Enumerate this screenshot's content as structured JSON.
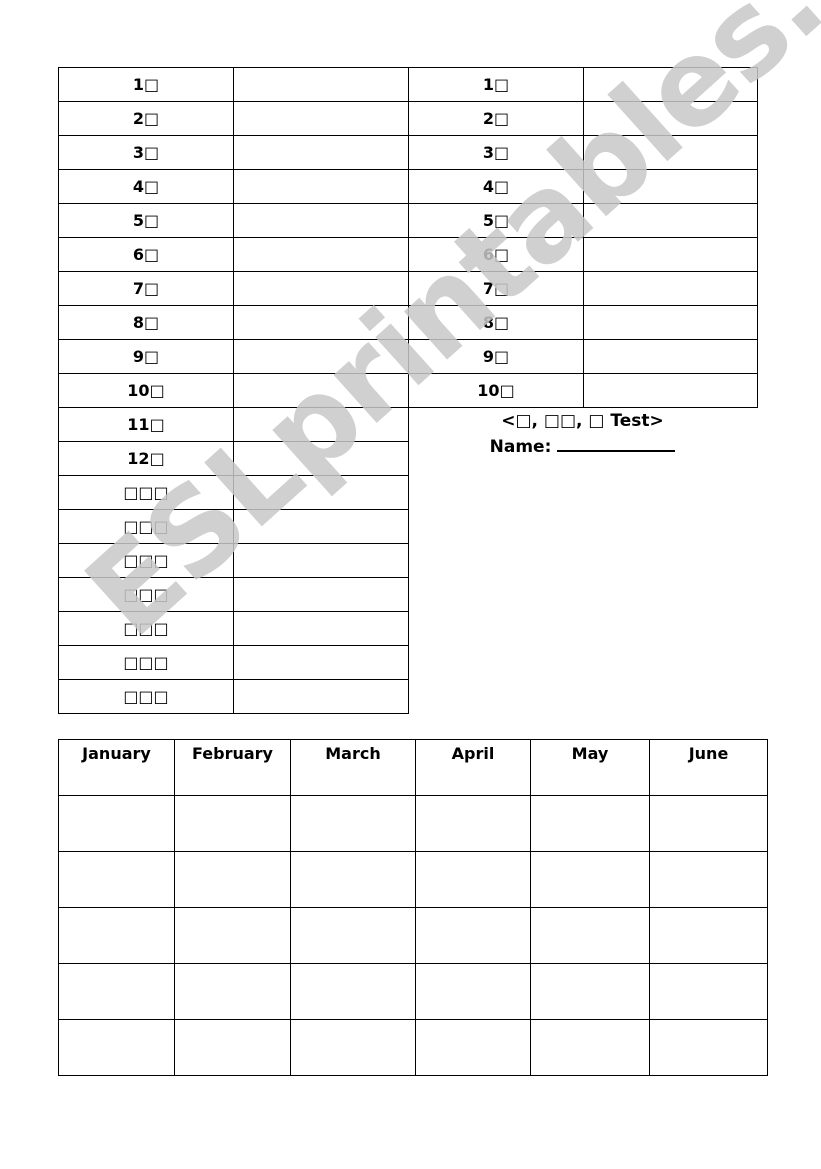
{
  "left_table": {
    "rows": [
      {
        "label": "1□"
      },
      {
        "label": "2□"
      },
      {
        "label": "3□"
      },
      {
        "label": "4□"
      },
      {
        "label": "5□"
      },
      {
        "label": "6□"
      },
      {
        "label": "7□"
      },
      {
        "label": "8□"
      },
      {
        "label": "9□"
      },
      {
        "label": "10□"
      },
      {
        "label": "11□"
      },
      {
        "label": "12□"
      },
      {
        "label": "□□□"
      },
      {
        "label": "□□□"
      },
      {
        "label": "□□□"
      },
      {
        "label": "□□□"
      },
      {
        "label": "□□□"
      },
      {
        "label": "□□□"
      },
      {
        "label": "□□□"
      }
    ]
  },
  "right_table": {
    "rows": [
      {
        "label": "1□"
      },
      {
        "label": "2□"
      },
      {
        "label": "3□"
      },
      {
        "label": "4□"
      },
      {
        "label": "5□"
      },
      {
        "label": "6□"
      },
      {
        "label": "7□"
      },
      {
        "label": "8□"
      },
      {
        "label": "9□"
      },
      {
        "label": "10□"
      }
    ]
  },
  "test_header": {
    "title": "<□, □□, □ Test>",
    "name_label": "Name:"
  },
  "month_table": {
    "headers": [
      "January",
      "February",
      "March",
      "April",
      "May",
      "June"
    ],
    "empty_rows": 5
  },
  "watermark": {
    "text": "ESLprintables.com",
    "color": "#c8c8c8"
  }
}
